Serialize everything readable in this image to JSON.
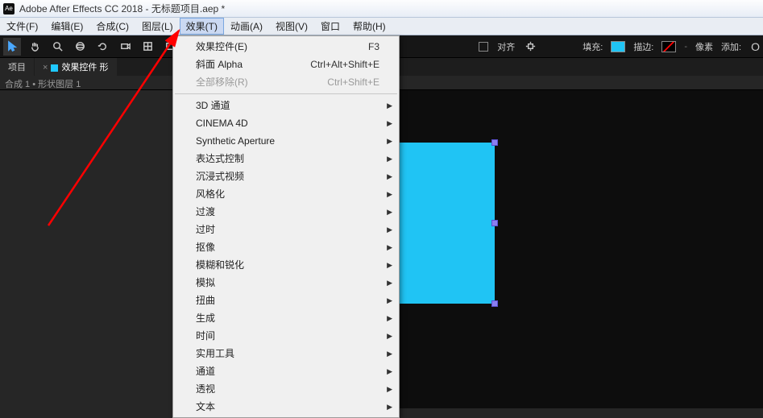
{
  "titlebar": {
    "appicon": "Ae",
    "title": "Adobe After Effects CC 2018 - 无标题项目.aep *"
  },
  "menus": {
    "file": "文件(F)",
    "edit": "编辑(E)",
    "composition": "合成(C)",
    "layer": "图层(L)",
    "effect": "效果(T)",
    "animation": "动画(A)",
    "view": "视图(V)",
    "window": "窗口",
    "help": "帮助(H)"
  },
  "toolbar": {
    "align": "对齐",
    "fill": "填充:",
    "stroke": "描边:",
    "unit": "像素",
    "add": "添加:"
  },
  "panels": {
    "project": "项目",
    "effectcontrols": "效果控件 形"
  },
  "status": "合成 1 • 形状图层 1",
  "dropdown": {
    "effectControls": {
      "label": "效果控件(E)",
      "shortcut": "F3"
    },
    "bevelAlpha": {
      "label": "斜面 Alpha",
      "shortcut": "Ctrl+Alt+Shift+E"
    },
    "removeAll": {
      "label": "全部移除(R)",
      "shortcut": "Ctrl+Shift+E"
    },
    "sub1": "3D 通道",
    "sub2": "CINEMA 4D",
    "sub3": "Synthetic Aperture",
    "sub4": "表达式控制",
    "sub5": "沉浸式视频",
    "sub6": "风格化",
    "sub7": "过渡",
    "sub8": "过时",
    "sub9": "抠像",
    "sub10": "模糊和锐化",
    "sub11": "模拟",
    "sub12": "扭曲",
    "sub13": "生成",
    "sub14": "时间",
    "sub15": "实用工具",
    "sub16": "通道",
    "sub17": "透视",
    "sub18": "文本"
  },
  "colors": {
    "fill": "#20c4f4",
    "strokeSwatch": "#000"
  }
}
